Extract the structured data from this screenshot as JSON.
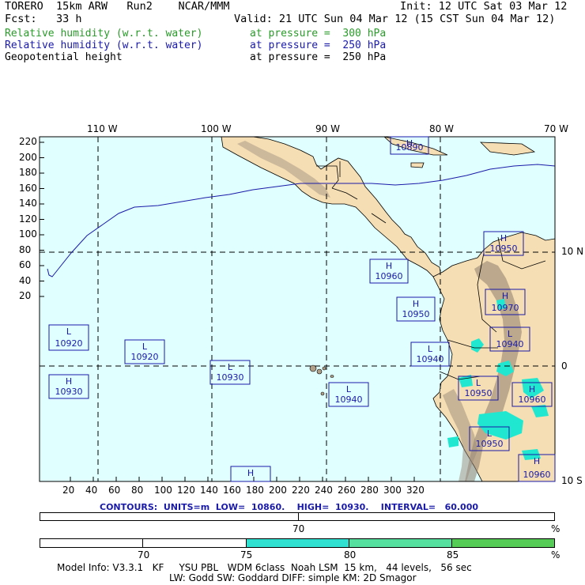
{
  "header": {
    "line1_left": "TORERO  15km ARW   Run2    NCAR/MMM",
    "line1_right": "Init: 12 UTC Sat 03 Mar 12",
    "line2_left": "Fcst:   33 h",
    "line2_right": "Valid: 21 UTC Sun 04 Mar 12 (15 CST Sun 04 Mar 12)",
    "fields": [
      {
        "name": "Relative humidity (w.r.t. water)",
        "level": "at pressure =  300 hPa",
        "color": "#2a9a2a"
      },
      {
        "name": "Relative humidity (w.r.t. water)",
        "level": "at pressure =  250 hPa",
        "color": "#1a1aa8"
      },
      {
        "name": "Geopotential height",
        "level": "at pressure =  250 hPa",
        "color": "#000000"
      }
    ]
  },
  "map": {
    "top_lon_labels": [
      "110 W",
      "100 W",
      "90 W",
      "80 W",
      "70 W"
    ],
    "right_lat_labels": [
      "10 N",
      "0",
      "10 S"
    ],
    "y_ticks": [
      "220",
      "200",
      "180",
      "160",
      "140",
      "120",
      "100",
      "80",
      "60",
      "40",
      "20"
    ],
    "x_ticks": [
      "20",
      "40",
      "60",
      "80",
      "100",
      "120",
      "140",
      "160",
      "180",
      "200",
      "220",
      "240",
      "260",
      "280",
      "300",
      "320"
    ],
    "highs_lows": [
      {
        "type": "H",
        "value": "10890"
      },
      {
        "type": "H",
        "value": "10950"
      },
      {
        "type": "H",
        "value": "10960"
      },
      {
        "type": "H",
        "value": "10970"
      },
      {
        "type": "H",
        "value": "10950"
      },
      {
        "type": "L",
        "value": "10940"
      },
      {
        "type": "L",
        "value": "10920"
      },
      {
        "type": "L",
        "value": "10920"
      },
      {
        "type": "L",
        "value": "10940"
      },
      {
        "type": "H",
        "value": "10930"
      },
      {
        "type": "L",
        "value": "10930"
      },
      {
        "type": "L",
        "value": "10940"
      },
      {
        "type": "L",
        "value": "10950"
      },
      {
        "type": "H",
        "value": "10960"
      },
      {
        "type": "L",
        "value": "10950"
      },
      {
        "type": "H",
        "value": "10960"
      },
      {
        "type": "H",
        "value": ""
      }
    ],
    "colors": {
      "ocean": "#e0ffff",
      "land": "#f5deb3",
      "rh_blue": "#1a1aa8",
      "rh_green": "#2a9a2a"
    }
  },
  "contour_info": "CONTOURS:  UNITS=m  LOW=  10860.    HIGH=  10930.    INTERVAL=   60.000",
  "bar1": {
    "label": "70",
    "unit": "%"
  },
  "bar2": {
    "labels": [
      "70",
      "75",
      "80",
      "85"
    ],
    "unit": "%",
    "colors": [
      "#ffffff",
      "#ffffff",
      "#30e0d0",
      "#55e0a0",
      "#55cc55"
    ]
  },
  "footer": {
    "line1": "Model Info: V3.3.1   KF     YSU PBL   WDM 6class  Noah LSM  15 km,   44 levels,   56 sec",
    "line2": "LW: Godd SW: Goddard DIFF: simple KM: 2D Smagor"
  }
}
